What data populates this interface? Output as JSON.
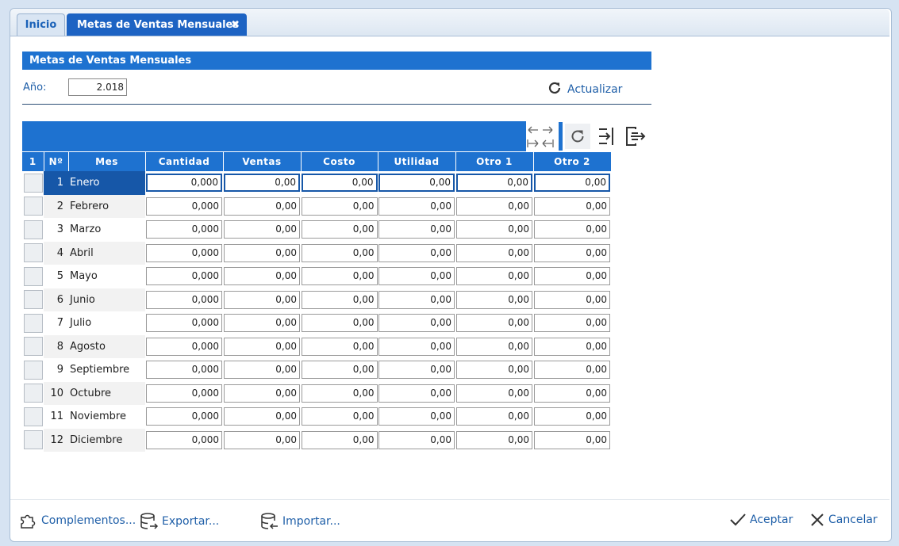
{
  "tabs": [
    {
      "label": "Inicio"
    },
    {
      "label": "Metas de Ventas Mensuales",
      "close_icon": "✖"
    }
  ],
  "panel": {
    "title": "Metas de Ventas Mensuales",
    "year_label": "Año:",
    "year_value": "2.018",
    "refresh_label": "Actualizar"
  },
  "grid": {
    "columns": [
      "1",
      "Nº",
      "Mes",
      "Cantidad",
      "Ventas",
      "Costo",
      "Utilidad",
      "Otro 1",
      "Otro 2"
    ],
    "rows": [
      {
        "n": "1",
        "mes": "Enero",
        "vals": [
          "0,000",
          "0,00",
          "0,00",
          "0,00",
          "0,00",
          "0,00"
        ]
      },
      {
        "n": "2",
        "mes": "Febrero",
        "vals": [
          "0,000",
          "0,00",
          "0,00",
          "0,00",
          "0,00",
          "0,00"
        ]
      },
      {
        "n": "3",
        "mes": "Marzo",
        "vals": [
          "0,000",
          "0,00",
          "0,00",
          "0,00",
          "0,00",
          "0,00"
        ]
      },
      {
        "n": "4",
        "mes": "Abril",
        "vals": [
          "0,000",
          "0,00",
          "0,00",
          "0,00",
          "0,00",
          "0,00"
        ]
      },
      {
        "n": "5",
        "mes": "Mayo",
        "vals": [
          "0,000",
          "0,00",
          "0,00",
          "0,00",
          "0,00",
          "0,00"
        ]
      },
      {
        "n": "6",
        "mes": "Junio",
        "vals": [
          "0,000",
          "0,00",
          "0,00",
          "0,00",
          "0,00",
          "0,00"
        ]
      },
      {
        "n": "7",
        "mes": "Julio",
        "vals": [
          "0,000",
          "0,00",
          "0,00",
          "0,00",
          "0,00",
          "0,00"
        ]
      },
      {
        "n": "8",
        "mes": "Agosto",
        "vals": [
          "0,000",
          "0,00",
          "0,00",
          "0,00",
          "0,00",
          "0,00"
        ]
      },
      {
        "n": "9",
        "mes": "Septiembre",
        "vals": [
          "0,000",
          "0,00",
          "0,00",
          "0,00",
          "0,00",
          "0,00"
        ]
      },
      {
        "n": "10",
        "mes": "Octubre",
        "vals": [
          "0,000",
          "0,00",
          "0,00",
          "0,00",
          "0,00",
          "0,00"
        ]
      },
      {
        "n": "11",
        "mes": "Noviembre",
        "vals": [
          "0,000",
          "0,00",
          "0,00",
          "0,00",
          "0,00",
          "0,00"
        ]
      },
      {
        "n": "12",
        "mes": "Diciembre",
        "vals": [
          "0,000",
          "0,00",
          "0,00",
          "0,00",
          "0,00",
          "0,00"
        ]
      }
    ],
    "selected_row": 1
  },
  "footer": {
    "complementos": "Complementos...",
    "exportar": "Exportar...",
    "importar": "Importar...",
    "aceptar": "Aceptar",
    "cancelar": "Cancelar"
  },
  "colors": {
    "accent": "#1e72d0",
    "selected": "#1657a8",
    "link": "#1f5fa8"
  }
}
